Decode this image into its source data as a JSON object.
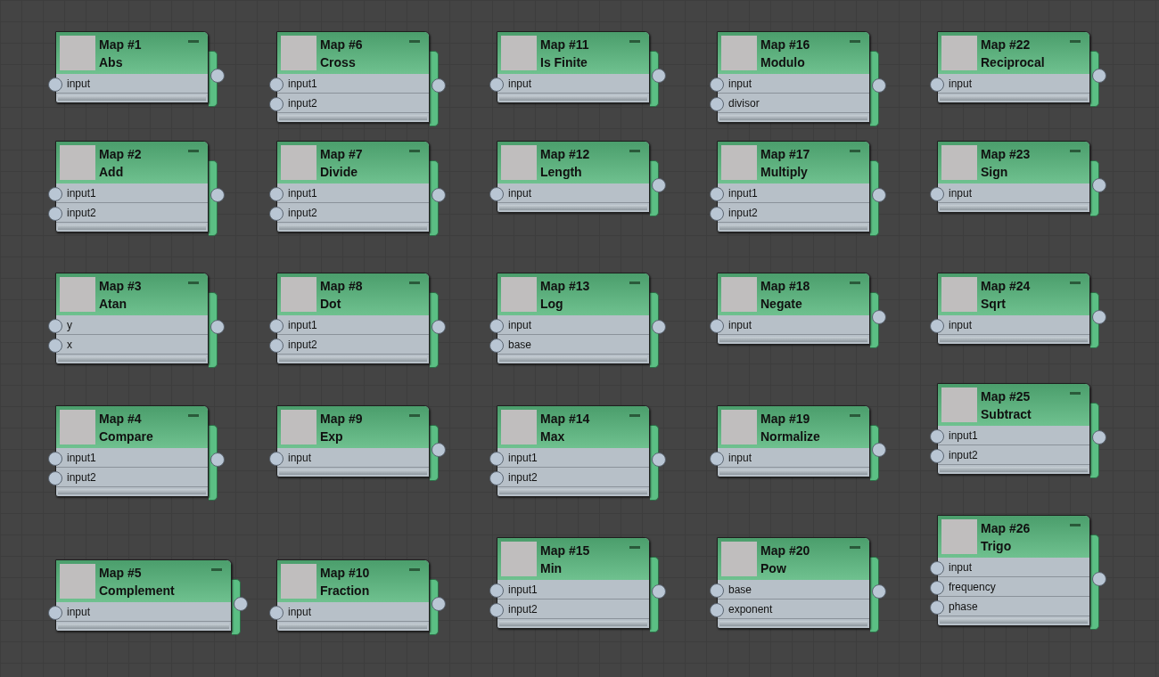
{
  "nodes": [
    {
      "title": "Map #1",
      "type": "Abs",
      "inputs": [
        "input"
      ]
    },
    {
      "title": "Map #2",
      "type": "Add",
      "inputs": [
        "input1",
        "input2"
      ]
    },
    {
      "title": "Map #3",
      "type": "Atan",
      "inputs": [
        "y",
        "x"
      ]
    },
    {
      "title": "Map #4",
      "type": "Compare",
      "inputs": [
        "input1",
        "input2"
      ]
    },
    {
      "title": "Map #5",
      "type": "Complement",
      "inputs": [
        "input"
      ]
    },
    {
      "title": "Map #6",
      "type": "Cross",
      "inputs": [
        "input1",
        "input2"
      ]
    },
    {
      "title": "Map #7",
      "type": "Divide",
      "inputs": [
        "input1",
        "input2"
      ]
    },
    {
      "title": "Map #8",
      "type": "Dot",
      "inputs": [
        "input1",
        "input2"
      ]
    },
    {
      "title": "Map #9",
      "type": "Exp",
      "inputs": [
        "input"
      ]
    },
    {
      "title": "Map #10",
      "type": "Fraction",
      "inputs": [
        "input"
      ]
    },
    {
      "title": "Map #11",
      "type": "Is Finite",
      "inputs": [
        "input"
      ]
    },
    {
      "title": "Map #12",
      "type": "Length",
      "inputs": [
        "input"
      ]
    },
    {
      "title": "Map #13",
      "type": "Log",
      "inputs": [
        "input",
        "base"
      ]
    },
    {
      "title": "Map #14",
      "type": "Max",
      "inputs": [
        "input1",
        "input2"
      ]
    },
    {
      "title": "Map #15",
      "type": "Min",
      "inputs": [
        "input1",
        "input2"
      ]
    },
    {
      "title": "Map #16",
      "type": "Modulo",
      "inputs": [
        "input",
        "divisor"
      ]
    },
    {
      "title": "Map #17",
      "type": "Multiply",
      "inputs": [
        "input1",
        "input2"
      ]
    },
    {
      "title": "Map #18",
      "type": "Negate",
      "inputs": [
        "input"
      ]
    },
    {
      "title": "Map #19",
      "type": "Normalize",
      "inputs": [
        "input"
      ]
    },
    {
      "title": "Map #20",
      "type": "Pow",
      "inputs": [
        "base",
        "exponent"
      ]
    },
    {
      "title": "Map #22",
      "type": "Reciprocal",
      "inputs": [
        "input"
      ]
    },
    {
      "title": "Map #23",
      "type": "Sign",
      "inputs": [
        "input"
      ]
    },
    {
      "title": "Map #24",
      "type": "Sqrt",
      "inputs": [
        "input"
      ]
    },
    {
      "title": "Map #25",
      "type": "Subtract",
      "inputs": [
        "input1",
        "input2"
      ]
    },
    {
      "title": "Map #26",
      "type": "Trigo",
      "inputs": [
        "input",
        "frequency",
        "phase"
      ]
    }
  ]
}
